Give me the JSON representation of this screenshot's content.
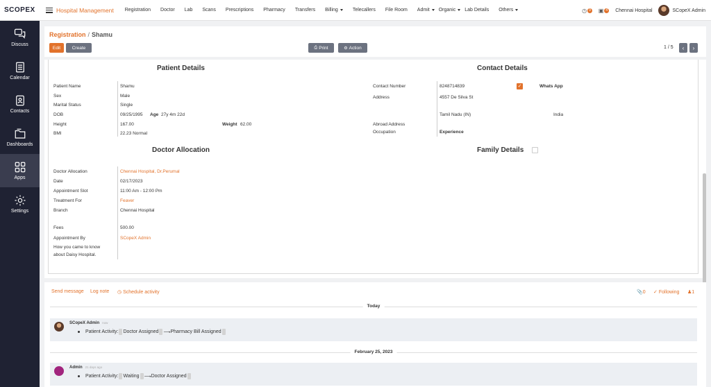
{
  "topbar": {
    "logo": "SCOPEX",
    "app_name": "Hospital Management",
    "menu": [
      {
        "label": "Registration",
        "caret": false
      },
      {
        "label": "Doctor",
        "caret": false
      },
      {
        "label": "Lab",
        "caret": false
      },
      {
        "label": "Scans",
        "caret": false
      },
      {
        "label": "Prescriptions",
        "caret": false
      },
      {
        "label": "Pharmacy",
        "caret": false
      },
      {
        "label": "Transfers",
        "caret": false
      },
      {
        "label": "Billing",
        "caret": true
      },
      {
        "label": "Telecallers",
        "caret": false
      },
      {
        "label": "File Room",
        "caret": false
      },
      {
        "label": "Admit",
        "caret": true
      },
      {
        "label": "Organic",
        "caret": true
      },
      {
        "label": "Lab Details",
        "caret": false
      },
      {
        "label": "Others",
        "caret": true
      }
    ],
    "activity_count": "9",
    "message_count": "4",
    "company": "Chennai Hospital",
    "user": "SCopeX Admin"
  },
  "sidebar": [
    {
      "label": "Discuss",
      "icon": "chat-icon"
    },
    {
      "label": "Calendar",
      "icon": "calendar-icon"
    },
    {
      "label": "Contacts",
      "icon": "contacts-icon"
    },
    {
      "label": "Dashboards",
      "icon": "dashboard-icon"
    },
    {
      "label": "Apps",
      "icon": "apps-grid-icon",
      "active": true
    },
    {
      "label": "Settings",
      "icon": "gear-icon"
    }
  ],
  "control": {
    "breadcrumb_parent": "Registration",
    "breadcrumb_sep": "/",
    "breadcrumb_current": "Shamu",
    "edit_label": "Edit",
    "create_label": "Create",
    "print_label": "Print",
    "action_label": "Action",
    "pager": "1 / 5"
  },
  "patient": {
    "title": "Patient Details",
    "name_label": "Patient Name",
    "name": "Shamu",
    "sex_label": "Sex",
    "sex": "Male",
    "marital_label": "Marital Status",
    "marital": "Single",
    "dob_label": "DOB",
    "dob": "09/25/1995",
    "age_label": "Age",
    "age": "27y 4m 22d",
    "height_label": "Height",
    "height": "167.00",
    "weight_label": "Weight",
    "weight": "62.00",
    "bmi_label": "BMI",
    "bmi": "22.23 Normal"
  },
  "contact": {
    "title": "Contact Details",
    "number_label": "Contact Number",
    "number": "8248714839",
    "whatsapp_label": "Whats App",
    "whatsapp_checked": true,
    "address_label": "Address",
    "street": "4557 De Silva St",
    "state": "Tamil Nadu (IN)",
    "country": "India",
    "abroad_label": "Abroad Address",
    "occupation_label": "Occupation",
    "experience_label": "Experience"
  },
  "doctor": {
    "title": "Doctor Allocation",
    "alloc_label": "Doctor Allocation",
    "alloc": "Chennai Hospital, Dr.Perumal",
    "date_label": "Date",
    "date": "02/17/2023",
    "slot_label": "Appointment Slot",
    "slot": "11:00 Am - 12:00 Pm",
    "treatment_label": "Treatment For",
    "treatment": "Feaver",
    "branch_label": "Branch",
    "branch": "Chennai Hospital",
    "fees_label": "Fees",
    "fees": "500.00",
    "appt_by_label": "Appointment By",
    "appt_by": "SCopeX Admin",
    "how_label_1": "How you came to know",
    "how_label_2": "about Daisy Hospital."
  },
  "family": {
    "title": "Family Details",
    "checked": false
  },
  "chatter": {
    "send_message": "Send message",
    "log_note": "Log note",
    "schedule": "Schedule activity",
    "attachments": "0",
    "following": "Following",
    "followers": "1",
    "today_label": "Today",
    "msg1_author": "SCopeX Admin",
    "msg1_time": "now",
    "msg1_prefix": "Patient Activity:",
    "msg1_from": "Doctor Assigned",
    "msg1_to": "Pharmacy Bill Assigned",
    "date2_label": "February 25, 2023",
    "msg2_author": "Admin",
    "msg2_time": "21 days ago",
    "msg2_prefix": "Patient Activity:",
    "msg2_from": "Waiting",
    "msg2_to": "Doctor Assigned"
  },
  "colors": {
    "accent": "#e2722b",
    "sidebar_bg": "#1f2233",
    "button_gray": "#6c7280"
  }
}
